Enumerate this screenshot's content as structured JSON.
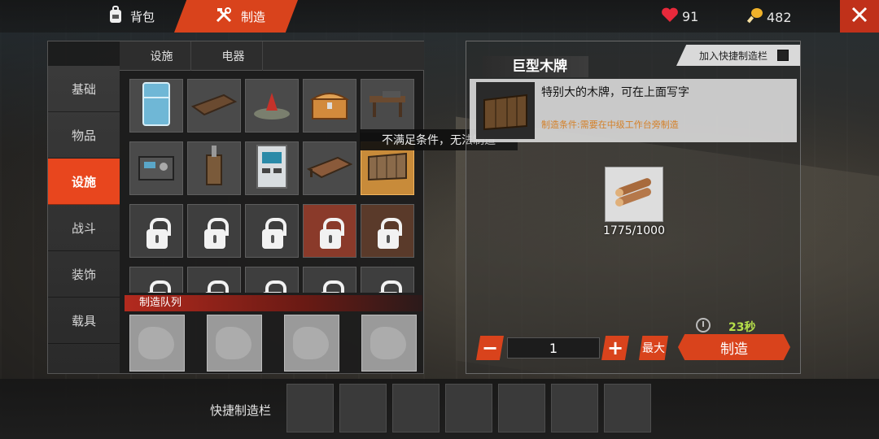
{
  "topbar": {
    "backpack_label": "背包",
    "craft_label": "制造",
    "hp": "91",
    "gold": "482",
    "hp_color": "#e8293b",
    "gold_color": "#f0b22a"
  },
  "categories": [
    {
      "label": "基础",
      "active": false
    },
    {
      "label": "物品",
      "active": false
    },
    {
      "label": "设施",
      "active": true
    },
    {
      "label": "战斗",
      "active": false
    },
    {
      "label": "装饰",
      "active": false
    },
    {
      "label": "载具",
      "active": false
    }
  ],
  "subtabs": [
    "设施",
    "电器"
  ],
  "grid_items": [
    {
      "icon": "fridge-icon",
      "locked": false
    },
    {
      "icon": "bed-frame-icon",
      "locked": false
    },
    {
      "icon": "campfire-icon",
      "locked": false
    },
    {
      "icon": "chest-icon",
      "locked": false
    },
    {
      "icon": "workbench-icon",
      "locked": false
    },
    {
      "icon": "machine-icon",
      "locked": false
    },
    {
      "icon": "distiller-icon",
      "locked": false
    },
    {
      "icon": "cabinet-icon",
      "locked": false
    },
    {
      "icon": "bed-icon",
      "locked": false
    },
    {
      "icon": "wooden-sign-icon",
      "locked": false,
      "selected": true
    },
    {
      "icon": "locked-item-icon",
      "locked": true
    },
    {
      "icon": "locked-item-icon",
      "locked": true
    },
    {
      "icon": "locked-item-icon",
      "locked": true
    },
    {
      "icon": "locked-item-icon",
      "locked": true
    },
    {
      "icon": "locked-item-icon",
      "locked": true
    },
    {
      "icon": "locked-item-icon",
      "locked": true
    },
    {
      "icon": "locked-item-icon",
      "locked": true
    },
    {
      "icon": "locked-item-icon",
      "locked": true
    },
    {
      "icon": "locked-item-icon",
      "locked": true
    },
    {
      "icon": "locked-item-icon",
      "locked": true
    }
  ],
  "tooltip": "不满足条件，无法制造",
  "queue": {
    "label": "制造队列",
    "slots": 4
  },
  "detail": {
    "title": "巨型木牌",
    "quick_add_label": "加入快捷制造栏",
    "description": "特别大的木牌，可在上面写字",
    "condition": "制造条件:需要在中级工作台旁制造",
    "material_icon": "wood-logs-icon",
    "material_count": "1775/1000",
    "time": "23秒",
    "quantity": "1",
    "minus_label": "−",
    "plus_label": "+",
    "max_label": "最大",
    "craft_label": "制造"
  },
  "quickbar": {
    "label": "快捷制造栏",
    "slots": 7
  }
}
